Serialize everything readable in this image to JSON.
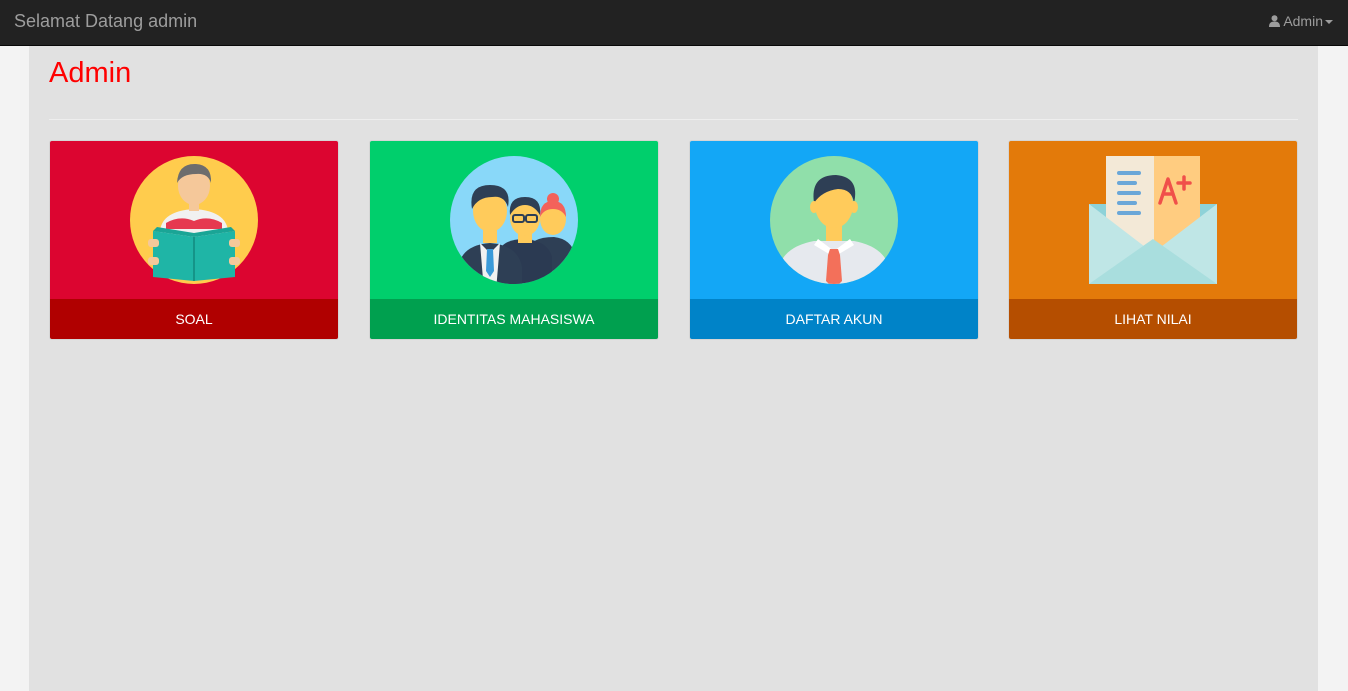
{
  "navbar": {
    "brand": "Selamat Datang admin",
    "user_label": "Admin",
    "user_icon": "user-icon",
    "caret_icon": "caret-down-icon"
  },
  "page": {
    "title": "Admin"
  },
  "tiles": [
    {
      "label": "SOAL",
      "icon": "student-reading-book-icon",
      "color": "#dc0530",
      "footer_color": "#b00000"
    },
    {
      "label": "IDENTITAS MAHASISWA",
      "icon": "group-of-people-icon",
      "color": "#00cf6c",
      "footer_color": "#00a04f"
    },
    {
      "label": "DAFTAR AKUN",
      "icon": "man-with-tie-avatar-icon",
      "color": "#13a7f6",
      "footer_color": "#0083c8"
    },
    {
      "label": "LIHAT NILAI",
      "icon": "envelope-grade-a-plus-icon",
      "color": "#e37a0a",
      "footer_color": "#b54e00"
    }
  ],
  "colors": {
    "navbar_bg": "#222222",
    "navbar_text": "#9d9d9d",
    "content_bg": "#e1e1e1",
    "title_red": "#ff0000"
  }
}
